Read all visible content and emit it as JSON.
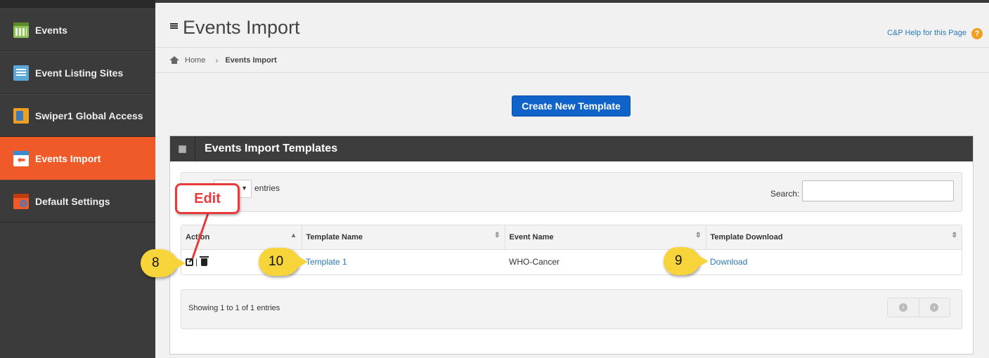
{
  "sidebar": {
    "items": [
      {
        "label": "Events",
        "icon": "calendar-icon",
        "active": false
      },
      {
        "label": "Event Listing Sites",
        "icon": "document-list-icon",
        "active": false
      },
      {
        "label": "Swiper1 Global Access",
        "icon": "device-icon",
        "active": false
      },
      {
        "label": "Events Import",
        "icon": "calendar-import-icon",
        "active": true
      },
      {
        "label": "Default Settings",
        "icon": "calendar-settings-icon",
        "active": false
      }
    ],
    "active_color": "#f05a28"
  },
  "header": {
    "title": "Events Import",
    "help_link": "C&P Help for this Page",
    "help_icon": "?"
  },
  "breadcrumb": {
    "home": "Home",
    "current": "Events Import"
  },
  "actions": {
    "create_label": "Create New Template",
    "create_color": "#1063c8"
  },
  "panel": {
    "title": "Events Import Templates",
    "length_suffix": "entries",
    "search_label": "Search:",
    "search_value": "",
    "columns": [
      "Action",
      "Template Name",
      "Event Name",
      "Template Download"
    ],
    "rows": [
      {
        "template_name": "Template 1",
        "event_name": "WHO-Cancer",
        "download": "Download"
      }
    ],
    "info": "Showing 1 to 1 of 1 entries"
  },
  "annotations": {
    "callout": "Edit",
    "badges": [
      "8",
      "10",
      "9"
    ]
  }
}
